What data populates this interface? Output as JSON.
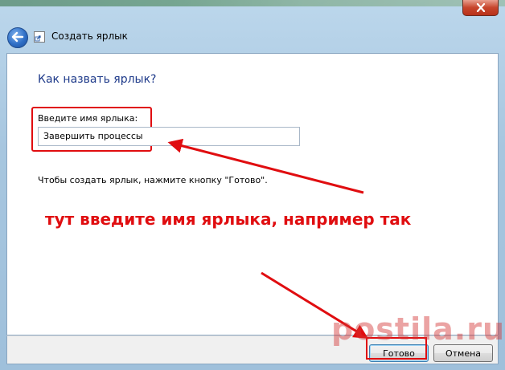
{
  "window": {
    "title": "Создать ярлык",
    "close_label": "close"
  },
  "wizard": {
    "heading": "Как назвать ярлык?",
    "field_label": "Введите имя ярлыка:",
    "field_value": "Завершить процессы",
    "hint": "Чтобы создать ярлык, нажмите кнопку \"Готово\"."
  },
  "buttons": {
    "done": "Готово",
    "cancel": "Отмена"
  },
  "annotation": {
    "text": "тут введите имя ярлыка, например так",
    "color": "#e00d10"
  },
  "watermark": {
    "text": "postila.ru"
  },
  "icons": {
    "back": "back-arrow-icon",
    "shortcut": "shortcut-icon",
    "close": "close-icon"
  }
}
